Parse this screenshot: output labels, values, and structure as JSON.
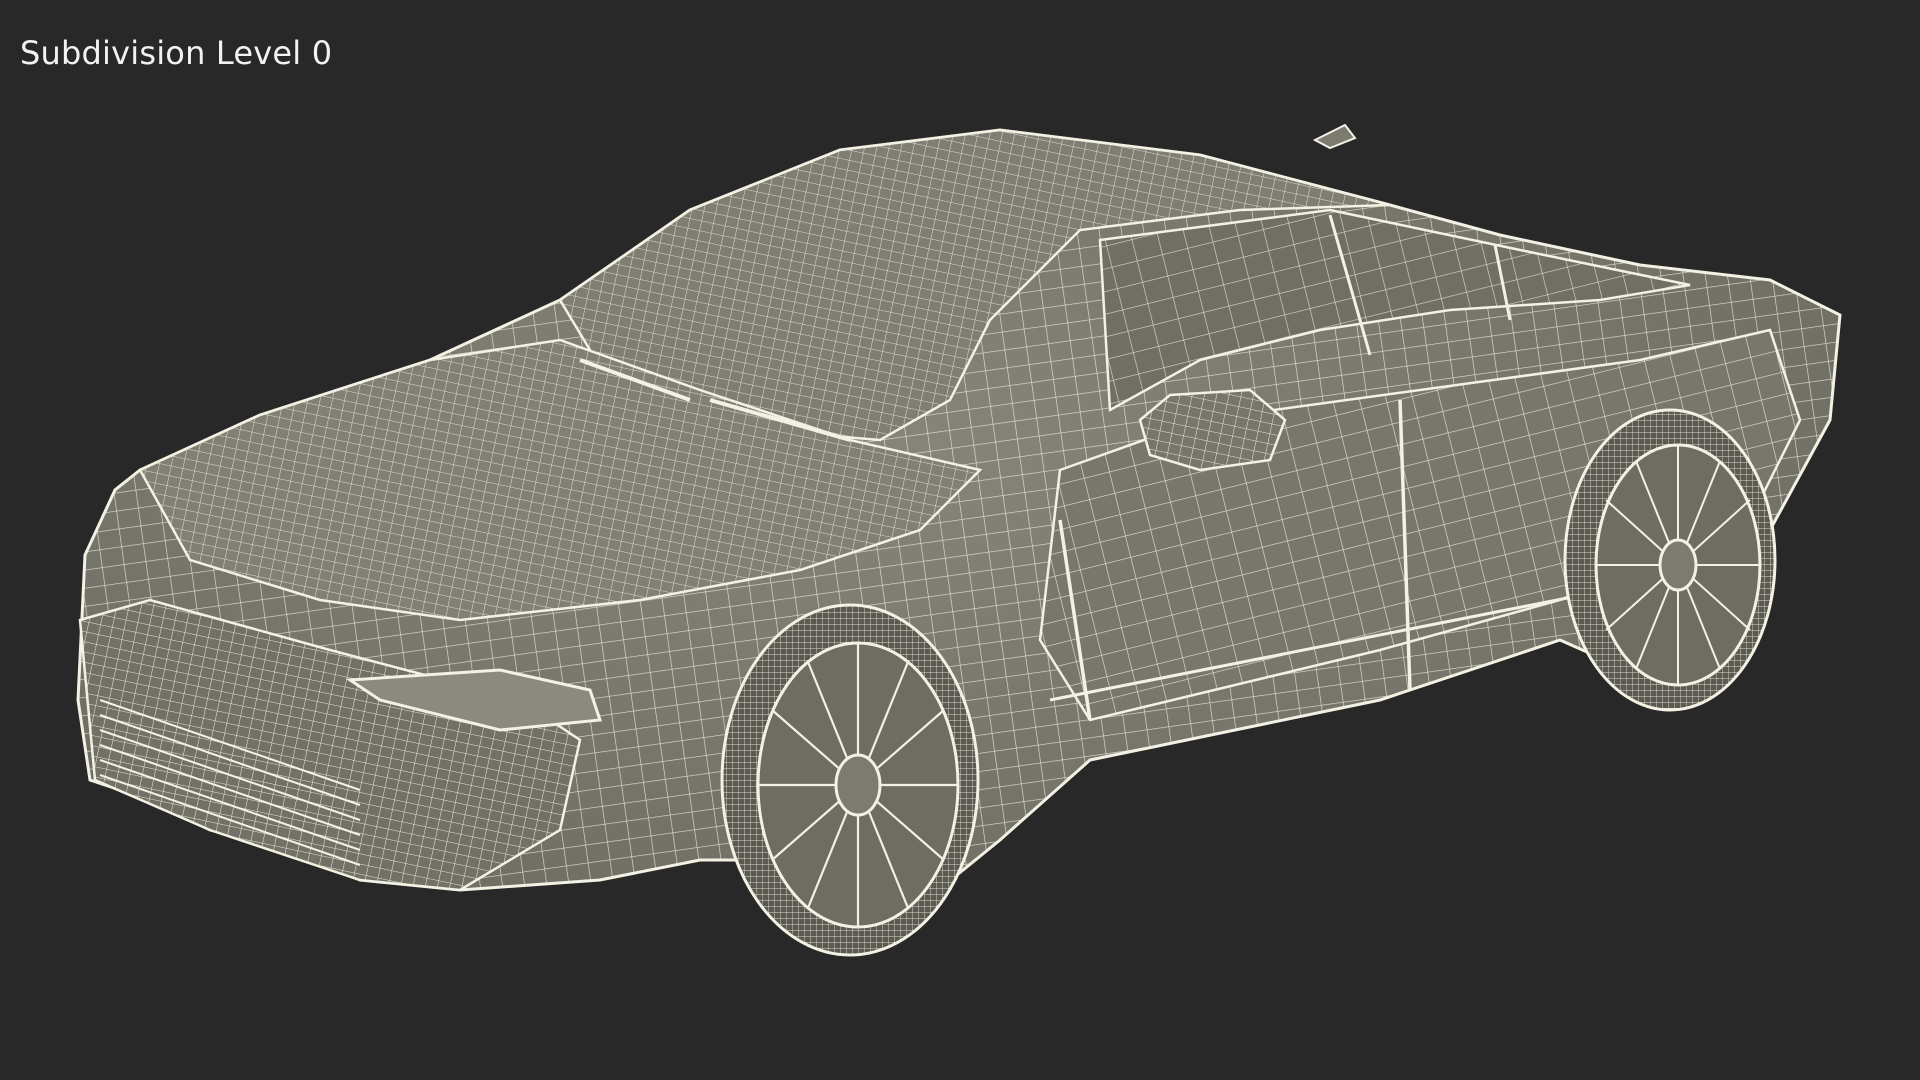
{
  "viewport": {
    "overlay_label": "Subdivision Level 0",
    "display_mode": "wireframe-on-shaded",
    "colors": {
      "background": "#282828",
      "mesh_fill": "#7b7b70",
      "mesh_shadow": "#65655c",
      "wire": "#f3f1e3",
      "tire": "#5a5a52",
      "label_text": "#f2f2f2"
    }
  },
  "scene": {
    "object": "sedan-car-model",
    "icon": "car-wireframe"
  }
}
